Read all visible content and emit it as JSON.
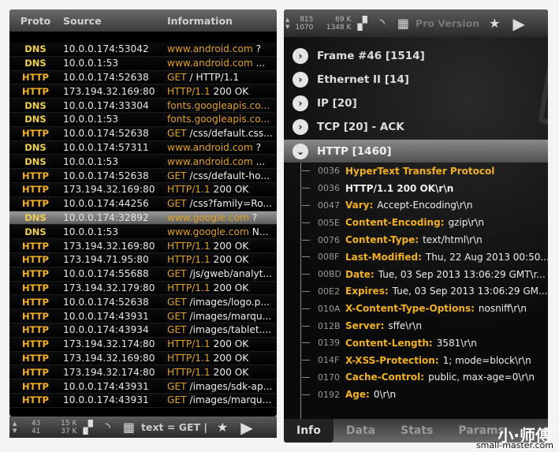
{
  "left": {
    "headers": [
      "Proto",
      "Source",
      "Information"
    ],
    "rows": [
      {
        "proto": "DNS",
        "source": "10.0.0.174:53042",
        "info_a": "www.android.com",
        "info_b": " ?"
      },
      {
        "proto": "DNS",
        "source": "10.0.0.1:53",
        "info_a": "www.android.com",
        "info_b": " ..."
      },
      {
        "proto": "HTTP",
        "source": "10.0.0.174:52638",
        "info_a": "GET",
        "info_b": " / HTTP/1.1"
      },
      {
        "proto": "HTTP",
        "source": "173.194.32.169:80",
        "info_a": "HTTP/1.1",
        "info_b": " 200 OK"
      },
      {
        "proto": "DNS",
        "source": "10.0.0.174:33304",
        "info_a": "fonts.googleapis.co...",
        "info_b": ""
      },
      {
        "proto": "DNS",
        "source": "10.0.0.1:53",
        "info_a": "fonts.googleapis.co...",
        "info_b": ""
      },
      {
        "proto": "HTTP",
        "source": "10.0.0.174:52638",
        "info_a": "GET",
        "info_b": " /css/default.css..."
      },
      {
        "proto": "DNS",
        "source": "10.0.0.174:57311",
        "info_a": "www.android.com",
        "info_b": " ?"
      },
      {
        "proto": "DNS",
        "source": "10.0.0.1:53",
        "info_a": "www.android.com",
        "info_b": " ..."
      },
      {
        "proto": "HTTP",
        "source": "10.0.0.174:52638",
        "info_a": "GET",
        "info_b": " /css/default-ho..."
      },
      {
        "proto": "HTTP",
        "source": "173.194.32.169:80",
        "info_a": "HTTP/1.1",
        "info_b": " 200 OK"
      },
      {
        "proto": "HTTP",
        "source": "10.0.0.174:44256",
        "info_a": "GET",
        "info_b": " /css?family=Ro..."
      },
      {
        "proto": "DNS",
        "source": "10.0.0.174:32892",
        "info_a": "www.google.com",
        "info_b": " ?",
        "selected": true
      },
      {
        "proto": "DNS",
        "source": "10.0.0.1:53",
        "info_a": "www.google.com",
        "info_b": " N..."
      },
      {
        "proto": "HTTP",
        "source": "173.194.32.169:80",
        "info_a": "HTTP/1.1",
        "info_b": " 200 OK"
      },
      {
        "proto": "HTTP",
        "source": "173.194.71.95:80",
        "info_a": "HTTP/1.1",
        "info_b": " 200 OK"
      },
      {
        "proto": "HTTP",
        "source": "10.0.0.174:55688",
        "info_a": "GET",
        "info_b": " /js/gweb/analyt..."
      },
      {
        "proto": "HTTP",
        "source": "173.194.32.179:80",
        "info_a": "HTTP/1.1",
        "info_b": " 200 OK"
      },
      {
        "proto": "HTTP",
        "source": "10.0.0.174:52638",
        "info_a": "GET",
        "info_b": " /images/logo.p..."
      },
      {
        "proto": "HTTP",
        "source": "10.0.0.174:43931",
        "info_a": "GET",
        "info_b": " /images/marqu..."
      },
      {
        "proto": "HTTP",
        "source": "10.0.0.174:43934",
        "info_a": "GET",
        "info_b": " /images/tablet...."
      },
      {
        "proto": "HTTP",
        "source": "173.194.32.174:80",
        "info_a": "HTTP/1.1",
        "info_b": " 200 OK"
      },
      {
        "proto": "HTTP",
        "source": "173.194.32.169:80",
        "info_a": "HTTP/1.1",
        "info_b": " 200 OK"
      },
      {
        "proto": "HTTP",
        "source": "173.194.32.174:80",
        "info_a": "HTTP/1.1",
        "info_b": " 200 OK"
      },
      {
        "proto": "HTTP",
        "source": "10.0.0.174:43931",
        "info_a": "GET",
        "info_b": " /images/sdk-ap..."
      },
      {
        "proto": "HTTP",
        "source": "10.0.0.174:43931",
        "info_a": "GET",
        "info_b": " /images/marqu..."
      }
    ],
    "toolbar": {
      "pkts_up": "43",
      "pkts_down": "41",
      "bytes_up": "15 K",
      "bytes_down": "37 K",
      "filter": "text = GET |"
    }
  },
  "right": {
    "toolbar": {
      "pkts_up": "815",
      "pkts_down": "1070",
      "bytes_up": "69 K",
      "bytes_down": "1348 K",
      "pro": "Pro Version"
    },
    "tree": [
      "Frame #46 [1514]",
      "Ethernet II [14]",
      "IP [20]",
      "TCP [20] - ACK",
      "HTTP [1460]"
    ],
    "fields": [
      {
        "off": "0036",
        "key": "HyperText Transfer Protocol",
        "val": ""
      },
      {
        "off": "0036",
        "key": "",
        "val": "HTTP/1.1 200 OK\\r\\n"
      },
      {
        "off": "0047",
        "key": "Vary:",
        "val": "Accept-Encoding\\r\\n"
      },
      {
        "off": "005E",
        "key": "Content-Encoding:",
        "val": "gzip\\r\\n"
      },
      {
        "off": "0076",
        "key": "Content-Type:",
        "val": "text/html\\r\\n"
      },
      {
        "off": "008F",
        "key": "Last-Modified:",
        "val": "Thu, 22 Aug 2013 00:50..."
      },
      {
        "off": "00BD",
        "key": "Date:",
        "val": "Tue, 03 Sep 2013 13:06:29 GMT\\r..."
      },
      {
        "off": "00E2",
        "key": "Expires:",
        "val": "Tue, 03 Sep 2013 13:06:29 GM..."
      },
      {
        "off": "010A",
        "key": "X-Content-Type-Options:",
        "val": "nosniff\\r\\n"
      },
      {
        "off": "012B",
        "key": "Server:",
        "val": "sffe\\r\\n"
      },
      {
        "off": "0139",
        "key": "Content-Length:",
        "val": "3581\\r\\n"
      },
      {
        "off": "014F",
        "key": "X-XSS-Protection:",
        "val": "1; mode=block\\r\\n"
      },
      {
        "off": "0170",
        "key": "Cache-Control:",
        "val": "public, max-age=0\\r\\n"
      },
      {
        "off": "0192",
        "key": "Age:",
        "val": "0\\r\\n"
      }
    ],
    "tabs": [
      "Info",
      "Data",
      "Stats",
      "Params"
    ]
  },
  "watermark": {
    "text": "小·师傅",
    "url": "small-master.com"
  }
}
